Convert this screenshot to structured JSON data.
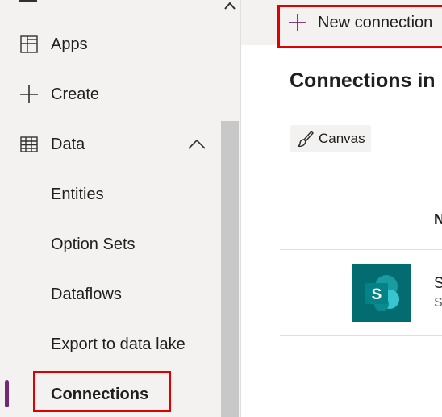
{
  "sidebar": {
    "items": [
      {
        "label": "Apps",
        "icon": "apps-icon"
      },
      {
        "label": "Create",
        "icon": "plus-icon"
      },
      {
        "label": "Data",
        "icon": "table-icon",
        "expanded": true
      },
      {
        "label": "Entities"
      },
      {
        "label": "Option Sets"
      },
      {
        "label": "Dataflows"
      },
      {
        "label": "Export to data lake"
      },
      {
        "label": "Connections",
        "selected": true
      }
    ]
  },
  "toolbar": {
    "new_connection_label": "New connection"
  },
  "main": {
    "heading": "Connections in",
    "filter_chip": "Canvas",
    "column_header": "N",
    "rows": [
      {
        "title": "S",
        "subtitle": "S",
        "icon": "sharepoint-icon",
        "icon_letter": "S"
      }
    ]
  },
  "colors": {
    "accent": "#742774",
    "highlight": "#e00000",
    "sharepoint": "#036c70",
    "sidebar_bg": "#f3f2f1"
  }
}
